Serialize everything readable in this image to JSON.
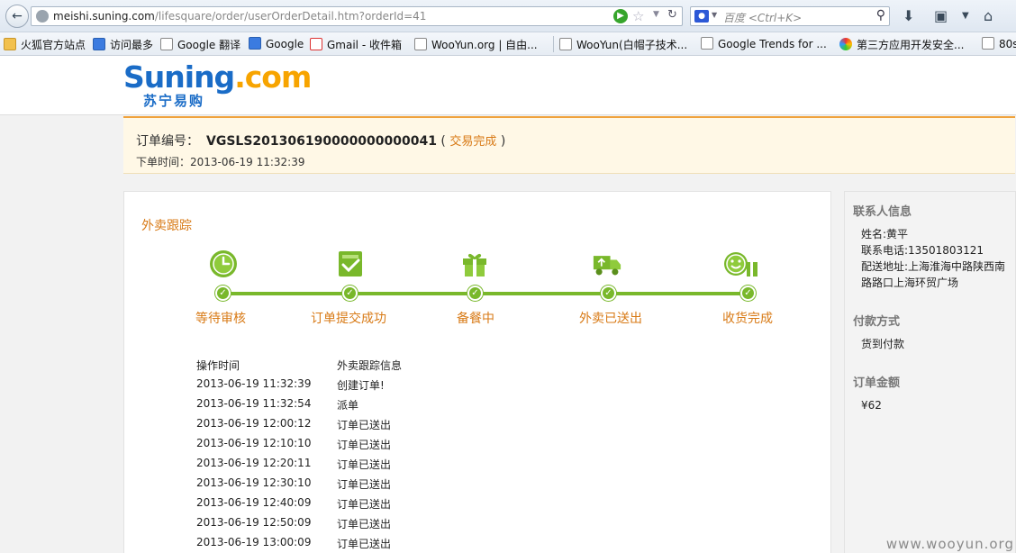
{
  "browser": {
    "url_host": "meishi.suning.com",
    "url_path": "/lifesquare/order/userOrderDetail.htm?orderId=41",
    "search_placeholder": "百度 <Ctrl+K>"
  },
  "bookmarks": [
    {
      "label": "火狐官方站点",
      "icon": "folder"
    },
    {
      "label": "访问最多",
      "icon": "blue"
    },
    {
      "label": "Google 翻译",
      "icon": "page"
    },
    {
      "label": "Google",
      "icon": "blue"
    },
    {
      "label": "Gmail - 收件箱",
      "icon": "red"
    },
    {
      "label": "WooYun.org | 自由...",
      "icon": "page"
    },
    {
      "label": "WooYun(白帽子技术...",
      "icon": "page"
    },
    {
      "label": "Google Trends for ...",
      "icon": "page"
    },
    {
      "label": "第三方应用开发安全...",
      "icon": "swirl"
    },
    {
      "label": "80s",
      "icon": "page"
    }
  ],
  "logo": {
    "main_part1": "Suning",
    "main_part2": ".com",
    "sub": "苏宁易购"
  },
  "order": {
    "number_label": "订单编号：",
    "number": "VGSLS201306190000000000041",
    "status": "交易完成",
    "time_label": "下单时间：",
    "time": "2013-06-19 11:32:39"
  },
  "tracking": {
    "title": "外卖跟踪",
    "steps": [
      {
        "label": "等待审核",
        "icon": "clock-icon"
      },
      {
        "label": "订单提交成功",
        "icon": "document-check-icon"
      },
      {
        "label": "备餐中",
        "icon": "gift-box-icon"
      },
      {
        "label": "外卖已送出",
        "icon": "delivery-truck-icon"
      },
      {
        "label": "收货完成",
        "icon": "smile-gift-icon"
      }
    ],
    "columns": {
      "time": "操作时间",
      "info": "外卖跟踪信息"
    },
    "rows": [
      {
        "time": "2013-06-19 11:32:39",
        "info": "创建订单!"
      },
      {
        "time": "2013-06-19 11:32:54",
        "info": "派单"
      },
      {
        "time": "2013-06-19 12:00:12",
        "info": "订单已送出"
      },
      {
        "time": "2013-06-19 12:10:10",
        "info": "订单已送出"
      },
      {
        "time": "2013-06-19 12:20:11",
        "info": "订单已送出"
      },
      {
        "time": "2013-06-19 12:30:10",
        "info": "订单已送出"
      },
      {
        "time": "2013-06-19 12:40:09",
        "info": "订单已送出"
      },
      {
        "time": "2013-06-19 12:50:09",
        "info": "订单已送出"
      },
      {
        "time": "2013-06-19 13:00:09",
        "info": "订单已送出"
      }
    ]
  },
  "contact": {
    "title": "联系人信息",
    "name": "姓名:黄平",
    "phone": "联系电话:13501803121",
    "address": "配送地址:上海淮海中路陕西南路路口上海环贸广场"
  },
  "payment": {
    "title": "付款方式",
    "value": "货到付款"
  },
  "amount": {
    "title": "订单金额",
    "value": "¥62"
  },
  "watermark": "www.wooyun.org",
  "colors": {
    "accent": "#d87a16",
    "track_green": "#79b82b",
    "brand_blue": "#1a6cc7",
    "brand_orange": "#f7a400"
  }
}
